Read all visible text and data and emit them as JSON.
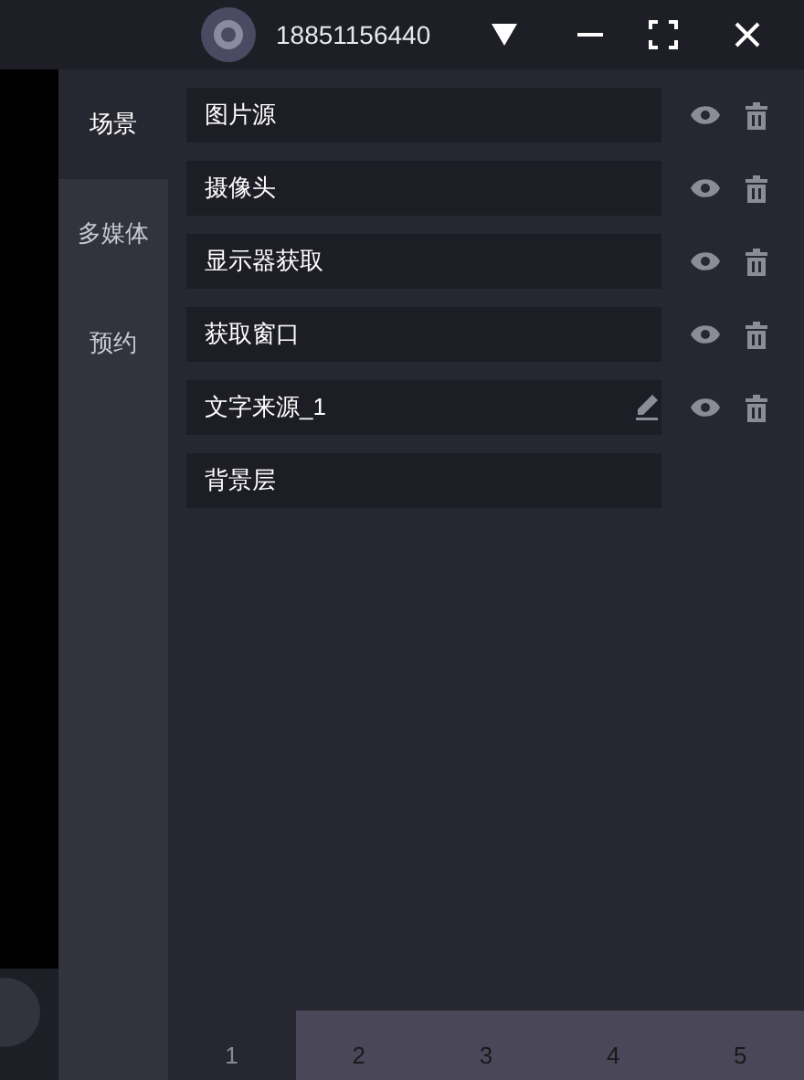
{
  "header": {
    "account": "18851156440"
  },
  "sidebar": {
    "tabs": [
      {
        "label": "场景",
        "selected": true
      },
      {
        "label": "多媒体",
        "selected": false
      },
      {
        "label": "预约",
        "selected": false
      }
    ]
  },
  "sources": [
    {
      "name": "图片源",
      "kind": "layer",
      "editable": false
    },
    {
      "name": "摄像头",
      "kind": "layer",
      "editable": false
    },
    {
      "name": "显示器获取",
      "kind": "layer",
      "editable": false
    },
    {
      "name": "获取窗口",
      "kind": "layer",
      "editable": false
    },
    {
      "name": "文字来源_1",
      "kind": "layer",
      "editable": true
    },
    {
      "name": "背景层",
      "kind": "base",
      "editable": false
    }
  ],
  "pages": [
    {
      "label": "1",
      "selected": true
    },
    {
      "label": "2",
      "selected": false
    },
    {
      "label": "3",
      "selected": false
    },
    {
      "label": "4",
      "selected": false
    },
    {
      "label": "5",
      "selected": false
    }
  ]
}
